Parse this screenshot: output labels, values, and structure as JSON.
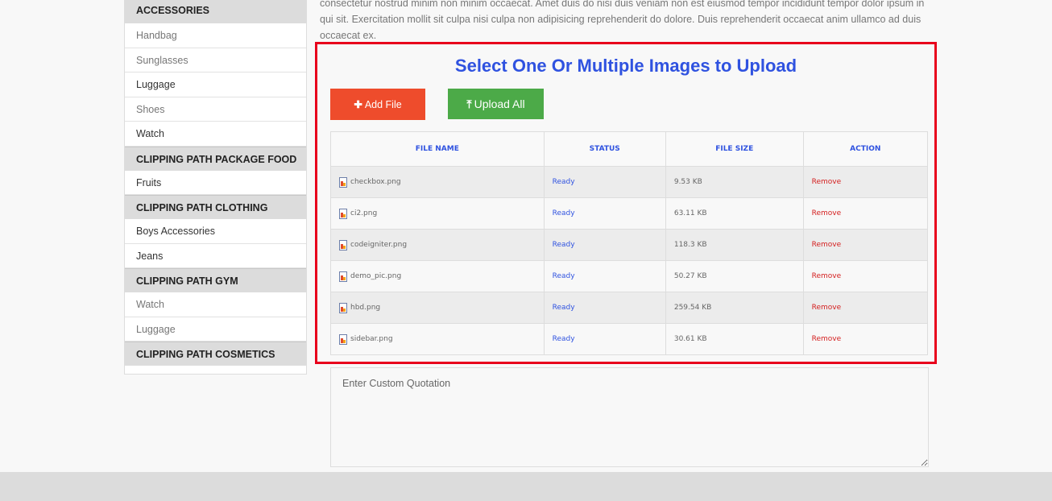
{
  "intro_text": "consectetur nostrud minim non minim occaecat. Amet duis do nisi duis veniam non est eiusmod tempor incididunt tempor dolor ipsum in qui sit. Exercitation mollit sit culpa nisi culpa non adipisicing reprehenderit do dolore. Duis reprehenderit occaecat anim ullamco ad duis occaecat ex.",
  "sidebar": {
    "groups": [
      {
        "header": "ACCESSORIES",
        "items": [
          "Handbag",
          "Sunglasses",
          "Luggage",
          "Shoes",
          "Watch"
        ]
      },
      {
        "header": "CLIPPING PATH PACKAGE FOOD",
        "items": [
          "Fruits"
        ]
      },
      {
        "header": "CLIPPING PATH CLOTHING",
        "items": [
          "Boys Accessories",
          "Jeans"
        ]
      },
      {
        "header": "CLIPPING PATH GYM",
        "items": [
          "Watch",
          "Luggage"
        ]
      },
      {
        "header": "CLIPPING PATH COSMETICS",
        "items": []
      }
    ]
  },
  "upload": {
    "title": "Select One Or Multiple Images to Upload",
    "add_label": "Add File",
    "upload_label": "Upload All",
    "add_icon": "plus-icon",
    "upload_icon": "upload-icon",
    "columns": [
      "FILE NAME",
      "STATUS",
      "FILE SIZE",
      "ACTION"
    ],
    "files": [
      {
        "name": "checkbox.png",
        "status": "Ready",
        "size": "9.53 KB",
        "action": "Remove"
      },
      {
        "name": "ci2.png",
        "status": "Ready",
        "size": "63.11 KB",
        "action": "Remove"
      },
      {
        "name": "codeigniter.png",
        "status": "Ready",
        "size": "118.3 KB",
        "action": "Remove"
      },
      {
        "name": "demo_pic.png",
        "status": "Ready",
        "size": "50.27 KB",
        "action": "Remove"
      },
      {
        "name": "hbd.png",
        "status": "Ready",
        "size": "259.54 KB",
        "action": "Remove"
      },
      {
        "name": "sidebar.png",
        "status": "Ready",
        "size": "30.61 KB",
        "action": "Remove"
      }
    ]
  },
  "quotation": {
    "placeholder": "Enter Custom Quotation"
  },
  "colors": {
    "title": "#2f52e0",
    "add_button": "#ee4c2c",
    "upload_button": "#4caa48",
    "highlight_border": "#e8001c",
    "remove": "#d42020"
  }
}
